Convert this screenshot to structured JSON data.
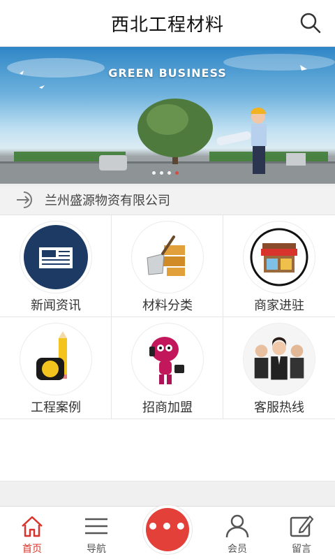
{
  "header": {
    "title": "西北工程材料",
    "search_icon": "search-icon"
  },
  "banner": {
    "headline": "GREEN BUSINESS",
    "slide_count": 4,
    "active_slide": 4
  },
  "notice": {
    "icon": "sign-in-arrow-icon",
    "text": "兰州盛源物资有限公司"
  },
  "grid": {
    "items": [
      {
        "label": "新闻资讯",
        "icon": "news-icon"
      },
      {
        "label": "材料分类",
        "icon": "trowel-bricks-icon"
      },
      {
        "label": "商家进驻",
        "icon": "storefront-icon"
      },
      {
        "label": "工程案例",
        "icon": "tape-pencil-icon"
      },
      {
        "label": "招商加盟",
        "icon": "mascot-phone-icon"
      },
      {
        "label": "客服热线",
        "icon": "service-team-icon"
      }
    ]
  },
  "tabbar": {
    "items": [
      {
        "label": "首页",
        "icon": "home-icon",
        "active": true
      },
      {
        "label": "导航",
        "icon": "menu-lines-icon",
        "active": false
      },
      {
        "label": "会员",
        "icon": "user-icon",
        "active": false
      },
      {
        "label": "留言",
        "icon": "edit-icon",
        "active": false
      }
    ],
    "center_icon": "more-dots-icon",
    "center_symbol": "•••"
  },
  "colors": {
    "accent": "#e4403a",
    "active_tab": "#d9342b",
    "notice_bg": "#f2f2f2"
  }
}
